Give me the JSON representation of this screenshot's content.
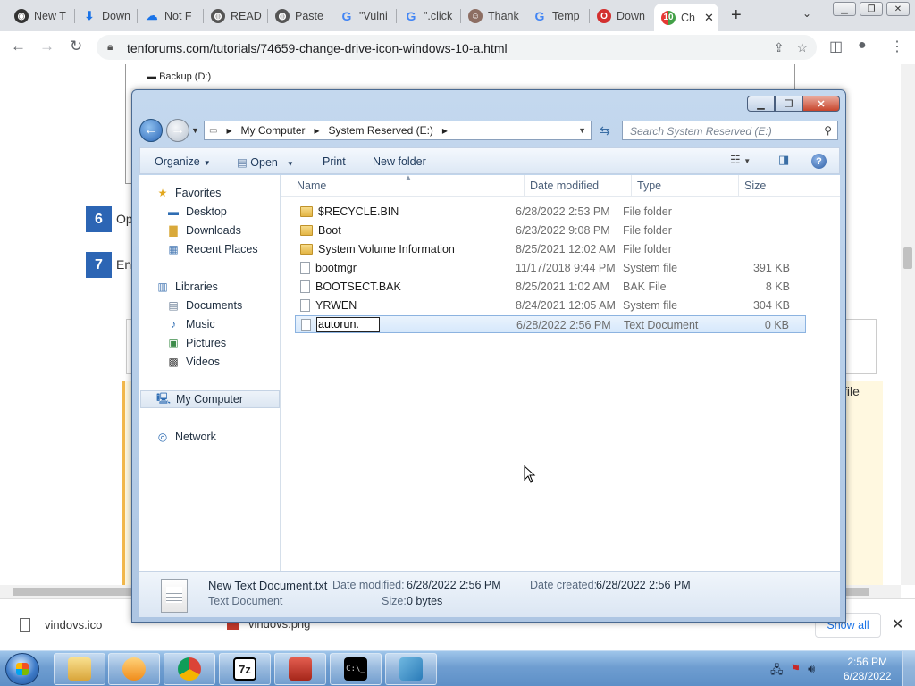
{
  "browser": {
    "tabs": [
      {
        "label": "New T",
        "icon": "github-icon",
        "color": "#333333"
      },
      {
        "label": "Down",
        "icon": "download-icon",
        "color": "#1a73e8"
      },
      {
        "label": "Not F",
        "icon": "cloudflare-icon",
        "color": "#1a73e8"
      },
      {
        "label": "READ",
        "icon": "globe-icon",
        "color": "#555555"
      },
      {
        "label": "Paste",
        "icon": "globe-icon",
        "color": "#555555"
      },
      {
        "label": "\"Vulni",
        "icon": "google-icon",
        "color": "#4285f4"
      },
      {
        "label": "\".click",
        "icon": "google-icon",
        "color": "#4285f4"
      },
      {
        "label": "Thank",
        "icon": "person-icon",
        "color": "#8d6e63"
      },
      {
        "label": "Temp",
        "icon": "google-icon",
        "color": "#4285f4"
      },
      {
        "label": "Down",
        "icon": "opera-icon",
        "color": "#d32f2f"
      },
      {
        "label": "Ch",
        "icon": "tenforums-icon",
        "color": "#e53935"
      }
    ],
    "url": "tenforums.com/tutorials/74659-change-drive-icon-windows-10-a.html"
  },
  "webpage": {
    "backup_label": "Backup (D:)",
    "steps": [
      {
        "num": "6",
        "text": "Op"
      },
      {
        "num": "7",
        "text": "En"
      }
    ],
    "side_text": "file"
  },
  "downloads": {
    "items": [
      {
        "name": "vindovs.ico"
      },
      {
        "name": "vindovs.png"
      }
    ],
    "show_all": "Show all"
  },
  "explorer": {
    "breadcrumb": [
      "My Computer",
      "System Reserved (E:)"
    ],
    "search_placeholder": "Search System Reserved (E:)",
    "commands": {
      "organize": "Organize",
      "open": "Open",
      "print": "Print",
      "new_folder": "New folder"
    },
    "nav": {
      "favorites": "Favorites",
      "desktop": "Desktop",
      "downloads": "Downloads",
      "recent": "Recent Places",
      "libraries": "Libraries",
      "documents": "Documents",
      "music": "Music",
      "pictures": "Pictures",
      "videos": "Videos",
      "my_computer": "My Computer",
      "network": "Network"
    },
    "columns": {
      "name": "Name",
      "date": "Date modified",
      "type": "Type",
      "size": "Size"
    },
    "files": [
      {
        "name": "$RECYCLE.BIN",
        "date": "6/28/2022 2:53 PM",
        "type": "File folder",
        "size": "",
        "kind": "folder"
      },
      {
        "name": "Boot",
        "date": "6/23/2022 9:08 PM",
        "type": "File folder",
        "size": "",
        "kind": "folder"
      },
      {
        "name": "System Volume Information",
        "date": "8/25/2021 12:02 AM",
        "type": "File folder",
        "size": "",
        "kind": "folder"
      },
      {
        "name": "bootmgr",
        "date": "11/17/2018 9:44 PM",
        "type": "System file",
        "size": "391 KB",
        "kind": "sysfile"
      },
      {
        "name": "BOOTSECT.BAK",
        "date": "8/25/2021 1:02 AM",
        "type": "BAK File",
        "size": "8 KB",
        "kind": "file"
      },
      {
        "name": "YRWEN",
        "date": "8/24/2021 12:05 AM",
        "type": "System file",
        "size": "304 KB",
        "kind": "sysfile"
      },
      {
        "name": "autorun.",
        "date": "6/28/2022 2:56 PM",
        "type": "Text Document",
        "size": "0 KB",
        "kind": "file",
        "renaming": true
      }
    ],
    "details": {
      "filename": "New Text Document.txt",
      "filetype": "Text Document",
      "date_modified_label": "Date modified:",
      "date_modified": "6/28/2022 2:56 PM",
      "date_created_label": "Date created:",
      "date_created": "6/28/2022 2:56 PM",
      "size_label": "Size:",
      "size": "0 bytes"
    }
  },
  "taskbar": {
    "time": "2:56 PM",
    "date": "6/28/2022"
  }
}
